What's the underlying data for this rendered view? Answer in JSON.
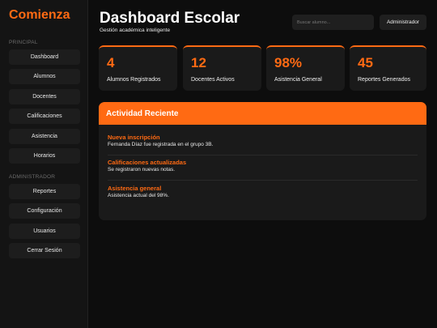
{
  "sidebar": {
    "brand": "Comienza",
    "section_principal": "PRINCIPAL",
    "section_admin": "ADMINISTRADOR",
    "items": [
      {
        "label": "Dashboard"
      },
      {
        "label": "Alumnos"
      },
      {
        "label": "Docentes"
      },
      {
        "label": "Calificaciones"
      },
      {
        "label": "Asistencia"
      },
      {
        "label": "Horarios"
      }
    ],
    "admin_items": [
      {
        "label": "Reportes"
      },
      {
        "label": "Configuración"
      },
      {
        "label": "Usuarios"
      },
      {
        "label": "Cerrar Sesión"
      }
    ]
  },
  "header": {
    "title": "Dashboard Escolar",
    "subtitle": "Gestión académica inteligente",
    "search_placeholder": "Buscar alumno...",
    "admin_label": "Administrador"
  },
  "stats": [
    {
      "value": "4",
      "label": "Alumnos Registrados"
    },
    {
      "value": "12",
      "label": "Docentes Activos"
    },
    {
      "value": "98%",
      "label": "Asistencia General"
    },
    {
      "value": "45",
      "label": "Reportes Generados"
    }
  ],
  "activity": {
    "title": "Actividad Reciente",
    "items": [
      {
        "title": "Nueva inscripción",
        "desc": "Fernanda Díaz fue registrada en el grupo 3B."
      },
      {
        "title": "Calificaciones actualizadas",
        "desc": "Se registraron nuevas notas."
      },
      {
        "title": "Asistencia general",
        "desc": "Asistencia actual del 98%."
      }
    ]
  },
  "colors": {
    "accent": "#ff6a13",
    "background": "#0d0d0d",
    "card": "#1a1a1a"
  }
}
